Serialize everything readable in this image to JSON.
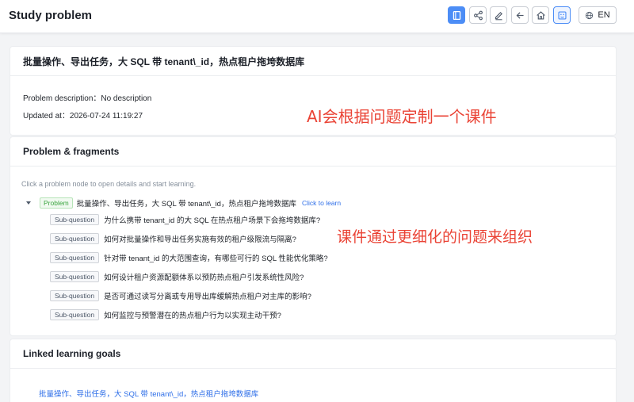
{
  "header": {
    "title": "Study problem",
    "language_label": "EN"
  },
  "overview": {
    "title": "批量操作、导出任务，大 SQL 带 tenant\\_id，热点租户拖垮数据库",
    "description_line": "Problem description：No description",
    "updated_line": "Updated at：2026-07-24 11:19:27",
    "annotation": "AI会根据问题定制一个课件"
  },
  "fragments": {
    "title": "Problem & fragments",
    "hint": "Click a problem node to open details and start learning.",
    "root": {
      "tag": "Problem",
      "text": "批量操作、导出任务，大 SQL 带 tenant\\_id，热点租户拖垮数据库",
      "link": "Click to learn"
    },
    "sub_tag": "Sub-question",
    "sub_questions": [
      "为什么携带 tenant_id 的大 SQL 在热点租户场景下会拖垮数据库?",
      "如何对批量操作和导出任务实施有效的租户级限流与隔离?",
      "针对带 tenant_id 的大范围查询，有哪些可行的 SQL 性能优化策略?",
      "如何设计租户资源配额体系以预防热点租户引发系统性风险?",
      "是否可通过读写分离或专用导出库缓解热点租户对主库的影响?",
      "如何监控与预警潜在的热点租户行为以实现主动干预?"
    ],
    "annotation": "课件通过更细化的问题来组织"
  },
  "goals": {
    "title": "Linked learning goals",
    "link": "批量操作、导出任务，大 SQL 带 tenant\\_id，热点租户拖垮数据库"
  },
  "colors": {
    "accent": "#4c8df6",
    "link": "#2f6fe8",
    "annotation": "#ea4335",
    "problem_tag": "#3aa53f"
  },
  "icons": [
    "book-icon",
    "share-icon",
    "edit-icon",
    "back-arrow-icon",
    "home-icon",
    "board-icon",
    "globe-icon"
  ]
}
